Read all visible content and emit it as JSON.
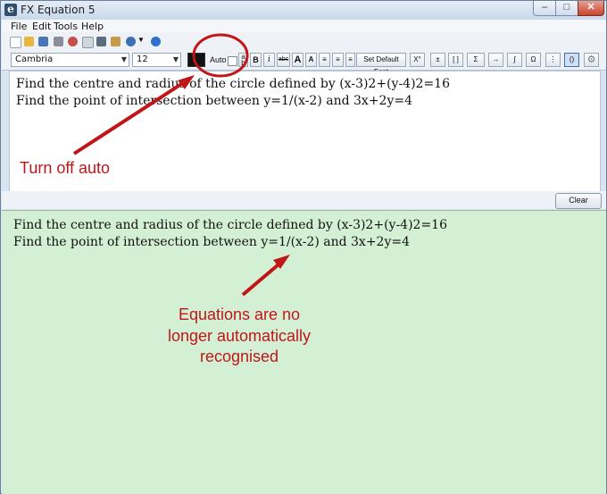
{
  "window": {
    "title": "FX Equation 5",
    "app_icon": "e",
    "min_glyph": "–",
    "max_glyph": "□",
    "close_glyph": "✕"
  },
  "menu": [
    {
      "label": "File"
    },
    {
      "label": "Edit"
    },
    {
      "label": "Tools"
    },
    {
      "label": "Help"
    }
  ],
  "toolbar1": {
    "icons": [
      {
        "name": "new-document-icon",
        "color": "#ffffff"
      },
      {
        "name": "open-folder-icon",
        "color": "#e8b640"
      },
      {
        "name": "save-icon",
        "color": "#4a76b8"
      },
      {
        "name": "print-icon",
        "color": "#8a8f99"
      },
      {
        "name": "cut-icon",
        "color": "#c4504a"
      },
      {
        "name": "copy-icon",
        "color": "#d0d6de"
      },
      {
        "name": "code-icon",
        "color": "#5a6b7f"
      },
      {
        "name": "paste-icon",
        "color": "#c79a4a"
      },
      {
        "name": "graph-icon",
        "color": "#3d6fb6"
      },
      {
        "name": "help-icon",
        "color": "#2e6fd0"
      }
    ]
  },
  "format": {
    "font": "Cambria",
    "size": "12",
    "auto_label": "Auto",
    "set_default_font": "Set Default Font",
    "bold": "B",
    "italic": "i",
    "strike": "abc",
    "grow": "A",
    "shrink": "A",
    "degree": "X°"
  },
  "editor": {
    "lines": [
      "Find the centre and radius of the circle defined by (x-3)2+(y-4)2=16",
      "Find the point of intersection between y=1/(x-2) and 3x+2y=4"
    ],
    "clear_button": "Clear"
  },
  "output": {
    "lines": [
      "Find the centre and radius of the circle defined by (x-3)2+(y-4)2=16",
      "Find the point of intersection between y=1/(x-2) and 3x+2y=4"
    ]
  },
  "annotations": {
    "turn_off": "Turn off auto",
    "equations_line1": "Equations are no",
    "equations_line2": "longer automatically",
    "equations_line3": "recognised",
    "color": "#c0161a"
  }
}
